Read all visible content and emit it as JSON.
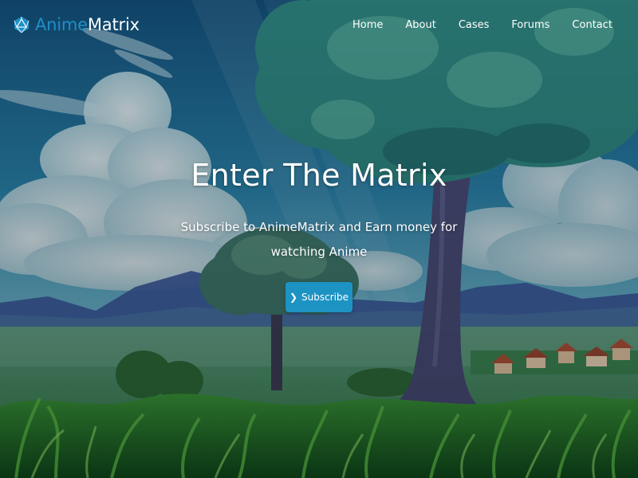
{
  "brand": {
    "part1": "Anime",
    "part2": "Matrix",
    "logo_icon": "d20-dice-icon",
    "accent": "#1f8fc6"
  },
  "nav": {
    "items": [
      {
        "label": "Home"
      },
      {
        "label": "About"
      },
      {
        "label": "Cases"
      },
      {
        "label": "Forums"
      },
      {
        "label": "Contact"
      }
    ]
  },
  "hero": {
    "title": "Enter The Matrix",
    "subtitle": "Subscribe to AnimeMatrix and Earn money for watching Anime",
    "cta": {
      "label": "Subscribe",
      "icon": "chevron-right-icon",
      "color": "#1d93c4"
    },
    "background": "anime-landscape-image"
  }
}
